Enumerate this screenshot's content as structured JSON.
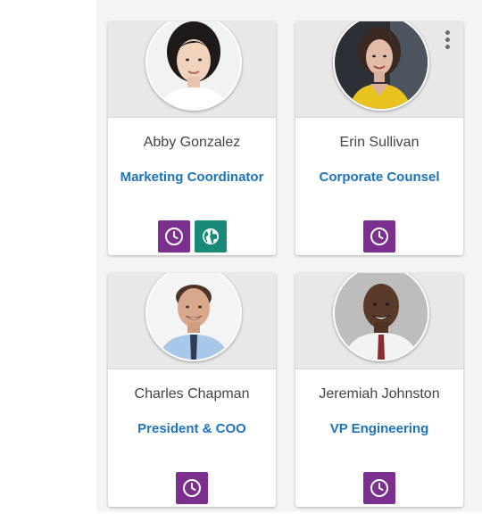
{
  "colors": {
    "name_text": "#444444",
    "title_link": "#1e73be",
    "clock_button": "#7b2f8e",
    "globe_button": "#1a8a78",
    "card_header": "#e8e8e8"
  },
  "cards": [
    {
      "name": "Abby Gonzalez",
      "title": "Marketing Coordinator",
      "actions": [
        {
          "icon": "clock-icon",
          "color": "#7b2f8e"
        },
        {
          "icon": "globe-icon",
          "color": "#1a8a78"
        }
      ]
    },
    {
      "name": "Erin Sullivan",
      "title": "Corporate Counsel",
      "menu": {
        "icon": "more-vertical-icon"
      },
      "actions": [
        {
          "icon": "clock-icon",
          "color": "#7b2f8e"
        }
      ]
    },
    {
      "name": "Charles Chapman",
      "title": "President & COO",
      "actions": [
        {
          "icon": "clock-icon",
          "color": "#7b2f8e"
        }
      ]
    },
    {
      "name": "Jeremiah Johnston",
      "title": "VP Engineering",
      "actions": [
        {
          "icon": "clock-icon",
          "color": "#7b2f8e"
        }
      ]
    }
  ]
}
